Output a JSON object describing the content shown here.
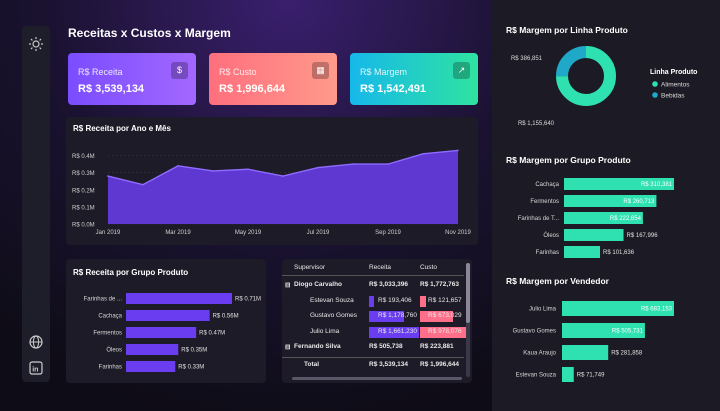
{
  "page": {
    "title": "Receitas x Custos x Margem"
  },
  "sidebar": {
    "icons": [
      "sun-icon",
      "globe-icon",
      "linkedin-icon"
    ]
  },
  "kpis": [
    {
      "label": "R$ Receita",
      "value": "R$ 3,539,134",
      "color_from": "#7b4dff",
      "color_to": "#a267ff",
      "icon": "money-icon"
    },
    {
      "label": "R$ Custo",
      "value": "R$ 1,996,644",
      "color_from": "#ff6f7d",
      "color_to": "#ff9a8b",
      "icon": "calculator-icon"
    },
    {
      "label": "R$ Margem",
      "value": "R$ 1,542,491",
      "color_from": "#16b8ea",
      "color_to": "#2fe3a0",
      "icon": "trend-icon"
    }
  ],
  "line_card": {
    "title": "R$ Receita por Ano e Mês"
  },
  "bar_card": {
    "title": "R$ Receita por Grupo Produto"
  },
  "table": {
    "headers": [
      "Supervisor",
      "Receita",
      "Custo"
    ],
    "rows": [
      {
        "name": "Diogo Carvalho",
        "receita": "R$ 3,033,396",
        "custo": "R$ 1,772,763",
        "bold": true,
        "expand": "⊟",
        "rbar": 0,
        "cbar": 0
      },
      {
        "name": "Estevan Souza",
        "receita": "R$ 193,406",
        "custo": "R$ 121,657",
        "bold": false,
        "expand": "",
        "rbar": 0.06,
        "cbar": 0.07
      },
      {
        "name": "Gustavo Gomes",
        "receita": "R$ 1,178,760",
        "custo": "R$ 673,029",
        "bold": false,
        "expand": "",
        "rbar": 0.39,
        "cbar": 0.38
      },
      {
        "name": "Julio Lima",
        "receita": "R$ 1,661,230",
        "custo": "R$ 978,076",
        "bold": false,
        "expand": "",
        "rbar": 0.55,
        "cbar": 0.55
      },
      {
        "name": "Fernando Silva",
        "receita": "R$ 505,738",
        "custo": "R$ 223,881",
        "bold": true,
        "expand": "⊟",
        "rbar": 0,
        "cbar": 0
      }
    ],
    "total": {
      "name": "Total",
      "receita": "R$ 3,539,134",
      "custo": "R$ 1,996,644"
    }
  },
  "donut_card": {
    "title": "R$ Margem por Linha Produto",
    "legend_title": "Linha Produto"
  },
  "grupo_card": {
    "title": "R$ Margem por Grupo Produto"
  },
  "vendedor_card": {
    "title": "R$ Margem por Vendedor"
  },
  "chart_data": [
    {
      "type": "area",
      "title": "R$ Receita por Ano e Mês",
      "x": [
        "Jan 2019",
        "Feb 2019",
        "Mar 2019",
        "Apr 2019",
        "May 2019",
        "Jun 2019",
        "Jul 2019",
        "Aug 2019",
        "Sep 2019",
        "Oct 2019",
        "Nov 2019"
      ],
      "x_ticks": [
        "Jan 2019",
        "Mar 2019",
        "May 2019",
        "Jul 2019",
        "Sep 2019",
        "Nov 2019"
      ],
      "values": [
        0.28,
        0.23,
        0.34,
        0.31,
        0.32,
        0.28,
        0.33,
        0.35,
        0.35,
        0.41,
        0.43
      ],
      "y_ticks": [
        "R$ 0.0M",
        "R$ 0.1M",
        "R$ 0.2M",
        "R$ 0.3M",
        "R$ 0.4M"
      ],
      "ylim": [
        0,
        0.45
      ],
      "color": "#6a3df0"
    },
    {
      "type": "bar",
      "title": "R$ Receita por Grupo Produto",
      "categories": [
        "Farinhas de ...",
        "Cachaça",
        "Fermentos",
        "Óleos",
        "Farinhas"
      ],
      "values": [
        0.71,
        0.56,
        0.47,
        0.35,
        0.33
      ],
      "labels": [
        "R$ 0.71M",
        "R$ 0.56M",
        "R$ 0.47M",
        "R$ 0.35M",
        "R$ 0.33M"
      ],
      "color": "#6a3df0"
    },
    {
      "type": "pie",
      "title": "R$ Margem por Linha Produto",
      "categories": [
        "Alimentos",
        "Bebidas"
      ],
      "values": [
        1155640,
        386851
      ],
      "labels": [
        "R$ 1,155,640",
        "R$ 386,851"
      ],
      "colors": [
        "#2fe0b0",
        "#1fa8c8"
      ]
    },
    {
      "type": "bar",
      "title": "R$ Margem por Grupo Produto",
      "categories": [
        "Cachaça",
        "Fermentos",
        "Farinhas de T...",
        "Óleos",
        "Farinhas"
      ],
      "values": [
        310381,
        260713,
        222654,
        167996,
        101636
      ],
      "labels": [
        "R$ 310,381",
        "R$ 260,713",
        "R$ 222,654",
        "R$ 167,996",
        "R$ 101,636"
      ],
      "color": "#2fe0b0"
    },
    {
      "type": "bar",
      "title": "R$ Margem por Vendedor",
      "categories": [
        "Julio Lima",
        "Gustavo Gomes",
        "Kaua Araujo",
        "Estevan Souza"
      ],
      "values": [
        683153,
        505731,
        281858,
        71749
      ],
      "labels": [
        "R$ 683,153",
        "R$ 505,731",
        "R$ 281,858",
        "R$ 71,749"
      ],
      "color": "#2fe0b0"
    }
  ]
}
